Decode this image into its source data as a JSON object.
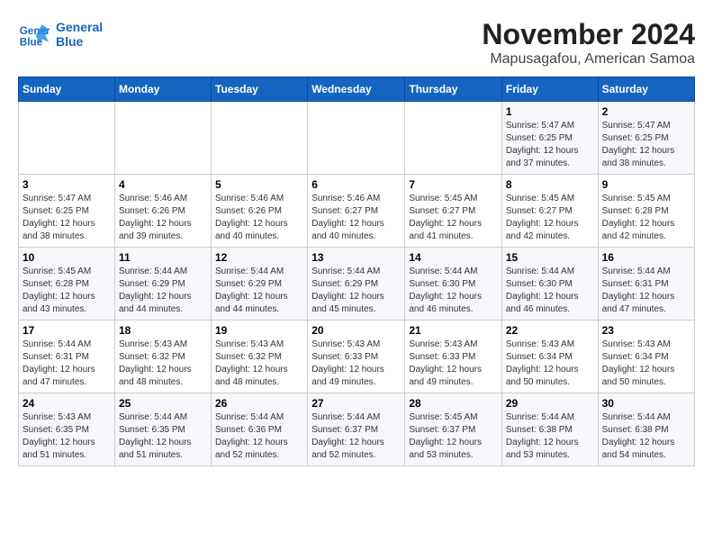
{
  "logo": {
    "line1": "General",
    "line2": "Blue"
  },
  "title": "November 2024",
  "location": "Mapusagafou, American Samoa",
  "weekdays": [
    "Sunday",
    "Monday",
    "Tuesday",
    "Wednesday",
    "Thursday",
    "Friday",
    "Saturday"
  ],
  "weeks": [
    [
      {
        "day": "",
        "info": ""
      },
      {
        "day": "",
        "info": ""
      },
      {
        "day": "",
        "info": ""
      },
      {
        "day": "",
        "info": ""
      },
      {
        "day": "",
        "info": ""
      },
      {
        "day": "1",
        "info": "Sunrise: 5:47 AM\nSunset: 6:25 PM\nDaylight: 12 hours and 37 minutes."
      },
      {
        "day": "2",
        "info": "Sunrise: 5:47 AM\nSunset: 6:25 PM\nDaylight: 12 hours and 38 minutes."
      }
    ],
    [
      {
        "day": "3",
        "info": "Sunrise: 5:47 AM\nSunset: 6:25 PM\nDaylight: 12 hours and 38 minutes."
      },
      {
        "day": "4",
        "info": "Sunrise: 5:46 AM\nSunset: 6:26 PM\nDaylight: 12 hours and 39 minutes."
      },
      {
        "day": "5",
        "info": "Sunrise: 5:46 AM\nSunset: 6:26 PM\nDaylight: 12 hours and 40 minutes."
      },
      {
        "day": "6",
        "info": "Sunrise: 5:46 AM\nSunset: 6:27 PM\nDaylight: 12 hours and 40 minutes."
      },
      {
        "day": "7",
        "info": "Sunrise: 5:45 AM\nSunset: 6:27 PM\nDaylight: 12 hours and 41 minutes."
      },
      {
        "day": "8",
        "info": "Sunrise: 5:45 AM\nSunset: 6:27 PM\nDaylight: 12 hours and 42 minutes."
      },
      {
        "day": "9",
        "info": "Sunrise: 5:45 AM\nSunset: 6:28 PM\nDaylight: 12 hours and 42 minutes."
      }
    ],
    [
      {
        "day": "10",
        "info": "Sunrise: 5:45 AM\nSunset: 6:28 PM\nDaylight: 12 hours and 43 minutes."
      },
      {
        "day": "11",
        "info": "Sunrise: 5:44 AM\nSunset: 6:29 PM\nDaylight: 12 hours and 44 minutes."
      },
      {
        "day": "12",
        "info": "Sunrise: 5:44 AM\nSunset: 6:29 PM\nDaylight: 12 hours and 44 minutes."
      },
      {
        "day": "13",
        "info": "Sunrise: 5:44 AM\nSunset: 6:29 PM\nDaylight: 12 hours and 45 minutes."
      },
      {
        "day": "14",
        "info": "Sunrise: 5:44 AM\nSunset: 6:30 PM\nDaylight: 12 hours and 46 minutes."
      },
      {
        "day": "15",
        "info": "Sunrise: 5:44 AM\nSunset: 6:30 PM\nDaylight: 12 hours and 46 minutes."
      },
      {
        "day": "16",
        "info": "Sunrise: 5:44 AM\nSunset: 6:31 PM\nDaylight: 12 hours and 47 minutes."
      }
    ],
    [
      {
        "day": "17",
        "info": "Sunrise: 5:44 AM\nSunset: 6:31 PM\nDaylight: 12 hours and 47 minutes."
      },
      {
        "day": "18",
        "info": "Sunrise: 5:43 AM\nSunset: 6:32 PM\nDaylight: 12 hours and 48 minutes."
      },
      {
        "day": "19",
        "info": "Sunrise: 5:43 AM\nSunset: 6:32 PM\nDaylight: 12 hours and 48 minutes."
      },
      {
        "day": "20",
        "info": "Sunrise: 5:43 AM\nSunset: 6:33 PM\nDaylight: 12 hours and 49 minutes."
      },
      {
        "day": "21",
        "info": "Sunrise: 5:43 AM\nSunset: 6:33 PM\nDaylight: 12 hours and 49 minutes."
      },
      {
        "day": "22",
        "info": "Sunrise: 5:43 AM\nSunset: 6:34 PM\nDaylight: 12 hours and 50 minutes."
      },
      {
        "day": "23",
        "info": "Sunrise: 5:43 AM\nSunset: 6:34 PM\nDaylight: 12 hours and 50 minutes."
      }
    ],
    [
      {
        "day": "24",
        "info": "Sunrise: 5:43 AM\nSunset: 6:35 PM\nDaylight: 12 hours and 51 minutes."
      },
      {
        "day": "25",
        "info": "Sunrise: 5:44 AM\nSunset: 6:35 PM\nDaylight: 12 hours and 51 minutes."
      },
      {
        "day": "26",
        "info": "Sunrise: 5:44 AM\nSunset: 6:36 PM\nDaylight: 12 hours and 52 minutes."
      },
      {
        "day": "27",
        "info": "Sunrise: 5:44 AM\nSunset: 6:37 PM\nDaylight: 12 hours and 52 minutes."
      },
      {
        "day": "28",
        "info": "Sunrise: 5:45 AM\nSunset: 6:37 PM\nDaylight: 12 hours and 53 minutes."
      },
      {
        "day": "29",
        "info": "Sunrise: 5:44 AM\nSunset: 6:38 PM\nDaylight: 12 hours and 53 minutes."
      },
      {
        "day": "30",
        "info": "Sunrise: 5:44 AM\nSunset: 6:38 PM\nDaylight: 12 hours and 54 minutes."
      }
    ]
  ]
}
